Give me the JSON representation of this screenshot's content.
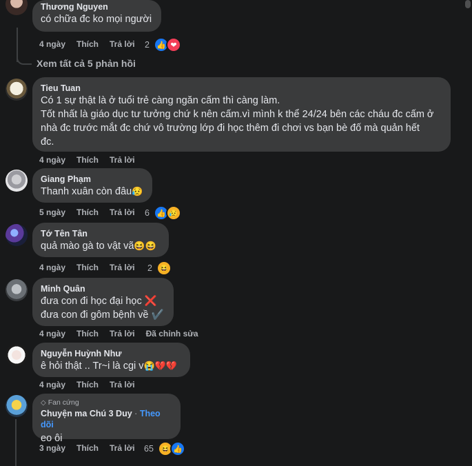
{
  "comments": [
    {
      "author": "Thương Nguyen",
      "text": "có chữa đc ko mọi người",
      "time": "4 ngày",
      "like": "Thích",
      "reply": "Trả lời",
      "reaction_count": "2",
      "reactions": [
        "like",
        "love"
      ]
    },
    {
      "author": "Tieu Tuan",
      "lines": [
        "Có 1 sự thật là ở tuổi trẻ càng ngăn cấm thì càng làm.",
        "Tốt nhất là giáo dục tư tưởng chứ k nên cấm.vì mình k thể 24/24 bên các cháu đc cấm ở",
        "nhà đc trước mắt đc chứ vô trường lớp đi học thêm đi chơi vs bạn bè đố mà quản hết",
        "đc."
      ],
      "time": "4 ngày",
      "like": "Thích",
      "reply": "Trả lời"
    },
    {
      "author": "Giang Phạm",
      "text": "Thanh xuân còn đâu",
      "time": "5 ngày",
      "like": "Thích",
      "reply": "Trả lời",
      "reaction_count": "6",
      "reactions": [
        "like",
        "sad"
      ]
    },
    {
      "author": "Tớ Tên Tân",
      "text": "quả mào gà to vật vã",
      "time": "4 ngày",
      "like": "Thích",
      "reply": "Trả lời",
      "reaction_count": "2",
      "reactions": [
        "haha"
      ]
    },
    {
      "author": "Minh Quân",
      "lines": [
        "đưa con đi học đại học ❌",
        "đưa con đi gôm bệnh về ✔️"
      ],
      "time": "4 ngày",
      "like": "Thích",
      "reply": "Trả lời",
      "edited": "Đã chỉnh sửa"
    },
    {
      "author": "Nguyễn Huỳnh Như",
      "text": "ê hỏi thật .. Tr~i là cgi v",
      "time": "4 ngày",
      "like": "Thích",
      "reply": "Trả lời"
    },
    {
      "badge": "Fan cứng",
      "author": "Chuyện ma Chú 3 Duy",
      "follow": "Theo dõi",
      "separator": "·",
      "text": "eo ôi",
      "time": "3 ngày",
      "like": "Thích",
      "reply": "Trả lời",
      "reaction_count": "65",
      "reactions": [
        "haha",
        "like"
      ]
    }
  ],
  "view_replies": "Xem tất cả 5 phản hồi",
  "emojis": {
    "haha": "😆",
    "sad": "😥",
    "cry": "😭",
    "broken": "💔",
    "like": "👍",
    "love": "❤"
  }
}
